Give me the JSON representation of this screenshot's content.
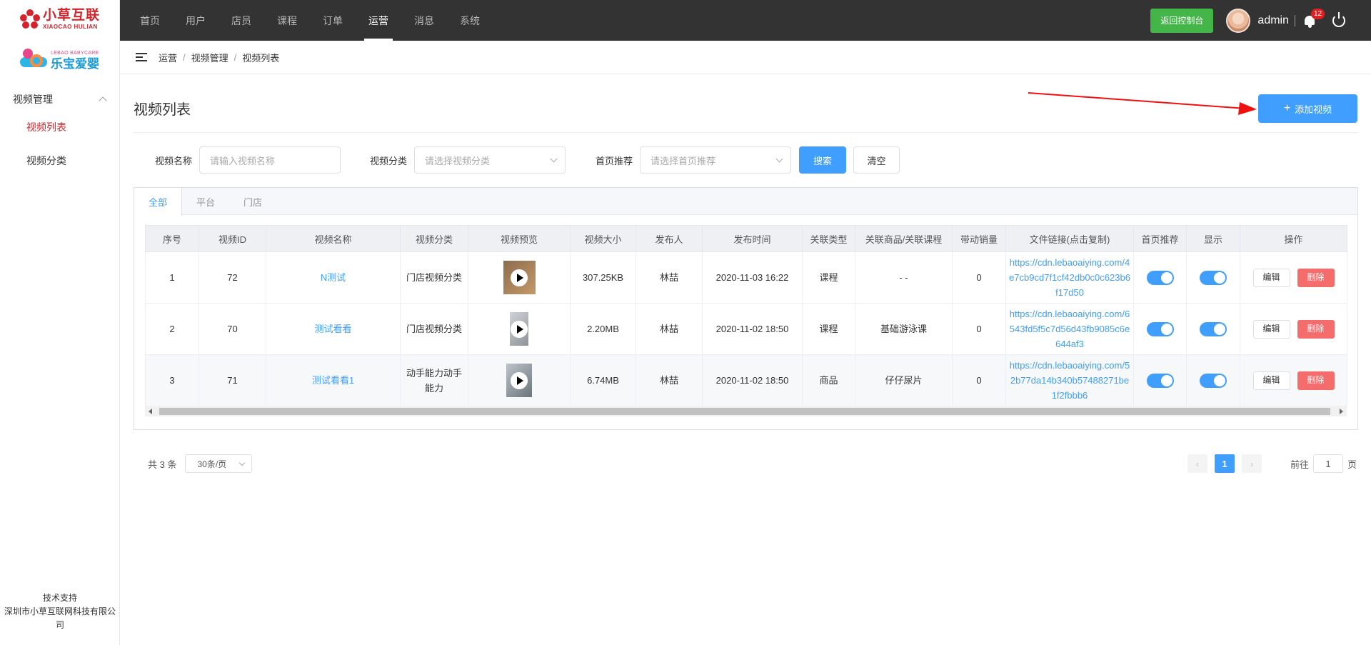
{
  "brand": {
    "logo1_zh": "小草互联",
    "logo1_en": "XIAOCAO HULIAN",
    "logo2_en": "LEBAO BABYCARE",
    "logo2_zh": "乐宝爱婴"
  },
  "sidebar": {
    "group_title": "视频管理",
    "items": [
      {
        "label": "视频列表"
      },
      {
        "label": "视频分类"
      }
    ],
    "support_title": "技术支持",
    "support_company": "深圳市小草互联网科技有限公司"
  },
  "topnav": {
    "items": [
      {
        "label": "首页"
      },
      {
        "label": "用户"
      },
      {
        "label": "店员"
      },
      {
        "label": "课程"
      },
      {
        "label": "订单"
      },
      {
        "label": "运营"
      },
      {
        "label": "消息"
      },
      {
        "label": "系统"
      }
    ],
    "console_label": "返回控制台",
    "username": "admin",
    "notification_count": "12"
  },
  "breadcrumb": [
    "运营",
    "视频管理",
    "视频列表"
  ],
  "page": {
    "title": "视频列表",
    "add_button": "添加视频"
  },
  "filters": {
    "name_label": "视频名称",
    "name_placeholder": "请输入视频名称",
    "category_label": "视频分类",
    "category_placeholder": "请选择视频分类",
    "recommend_label": "首页推荐",
    "recommend_placeholder": "请选择首页推荐",
    "search_label": "搜索",
    "clear_label": "清空"
  },
  "tabs": [
    {
      "label": "全部"
    },
    {
      "label": "平台"
    },
    {
      "label": "门店"
    }
  ],
  "table": {
    "headers": [
      "序号",
      "视频ID",
      "视频名称",
      "视频分类",
      "视频预览",
      "视频大小",
      "发布人",
      "发布时间",
      "关联类型",
      "关联商品/关联课程",
      "带动销量",
      "文件链接(点击复制)",
      "首页推荐",
      "显示",
      "操作"
    ],
    "rows": [
      {
        "index": "1",
        "id": "72",
        "name": "N测试",
        "category": "门店视频分类",
        "size": "307.25KB",
        "publisher": "林喆",
        "time": "2020-11-03 16:22",
        "rel_type": "课程",
        "rel_item": "- -",
        "sales": "0",
        "url": "https://cdn.lebaoaiying.com/4e7cb9cd7f1cf42db0c0c623b6f17d50",
        "recommend": true,
        "visible": true
      },
      {
        "index": "2",
        "id": "70",
        "name": "测试看看",
        "category": "门店视频分类",
        "size": "2.20MB",
        "publisher": "林喆",
        "time": "2020-11-02 18:50",
        "rel_type": "课程",
        "rel_item": "基础游泳课",
        "sales": "0",
        "url": "https://cdn.lebaoaiying.com/6543fd5f5c7d56d43fb9085c6e644af3",
        "recommend": true,
        "visible": true
      },
      {
        "index": "3",
        "id": "71",
        "name": "测试看看1",
        "category": "动手能力动手能力",
        "size": "6.74MB",
        "publisher": "林喆",
        "time": "2020-11-02 18:50",
        "rel_type": "商品",
        "rel_item": "仔仔尿片",
        "sales": "0",
        "url": "https://cdn.lebaoaiying.com/52b77da14b340b57488271be1f2fbbb6",
        "recommend": true,
        "visible": true
      }
    ],
    "edit_label": "编辑",
    "delete_label": "删除"
  },
  "pagination": {
    "total_text": "共 3 条",
    "page_size": "30条/页",
    "current_page": "1",
    "goto_prefix": "前往",
    "goto_value": "1",
    "goto_suffix": "页"
  },
  "colors": {
    "primary": "#409eff",
    "danger": "#f56c6c",
    "success": "#44b549",
    "topbar": "#333333",
    "brand_red": "#d4232b"
  }
}
